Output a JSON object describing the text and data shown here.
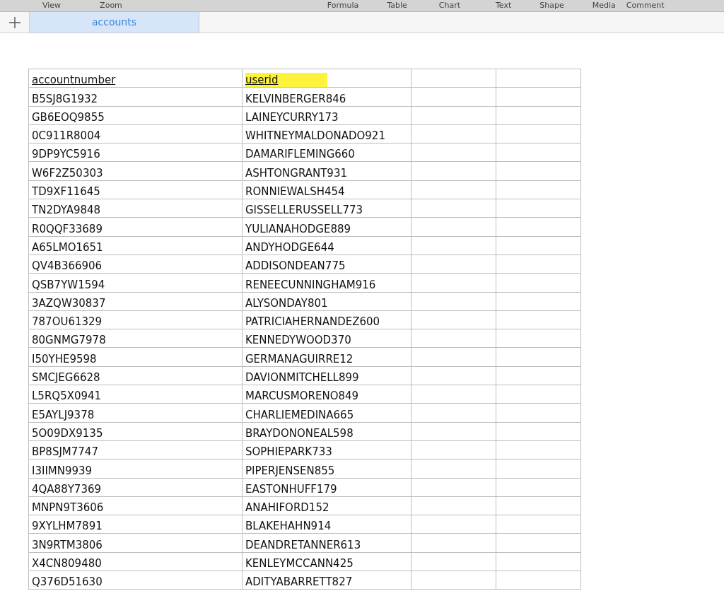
{
  "toolbar": {
    "items": [
      "View",
      "Zoom",
      "Formula",
      "Table",
      "Chart",
      "Text",
      "Shape",
      "Media",
      "Comment"
    ]
  },
  "sheet_tabs": [
    {
      "label": "accounts",
      "selected": true
    }
  ],
  "table": {
    "columns": [
      {
        "label": "accountnumber",
        "highlighted": false
      },
      {
        "label": "userid",
        "highlighted": true
      }
    ],
    "rows": [
      [
        "B5SJ8G1932",
        "KELVINBERGER846"
      ],
      [
        "GB6EOQ9855",
        "LAINEYCURRY173"
      ],
      [
        "0C911R8004",
        "WHITNEYMALDONADO921"
      ],
      [
        "9DP9YC5916",
        "DAMARIFLEMING660"
      ],
      [
        "W6F2Z50303",
        "ASHTONGRANT931"
      ],
      [
        "TD9XF11645",
        "RONNIEWALSH454"
      ],
      [
        "TN2DYA9848",
        "GISSELLERUSSELL773"
      ],
      [
        "R0QQF33689",
        "YULIANAHODGE889"
      ],
      [
        "A65LMO1651",
        "ANDYHODGE644"
      ],
      [
        "QV4B366906",
        "ADDISONDEAN775"
      ],
      [
        "QSB7YW1594",
        "RENEECUNNINGHAM916"
      ],
      [
        "3AZQW30837",
        "ALYSONDAY801"
      ],
      [
        "787OU61329",
        "PATRICIAHERNANDEZ600"
      ],
      [
        "80GNMG7978",
        "KENNEDYWOOD370"
      ],
      [
        "I50YHE9598",
        "GERMANAGUIRRE12"
      ],
      [
        "SMCJEG6628",
        "DAVIONMITCHELL899"
      ],
      [
        "L5RQ5X0941",
        "MARCUSMORENO849"
      ],
      [
        "E5AYLJ9378",
        "CHARLIEMEDINA665"
      ],
      [
        "5O09DX9135",
        "BRAYDONONEAL598"
      ],
      [
        "BP8SJM7747",
        "SOPHIEPARK733"
      ],
      [
        "I3IIMN9939",
        "PIPERJENSEN855"
      ],
      [
        "4QA88Y7369",
        "EASTONHUFF179"
      ],
      [
        "MNPN9T3606",
        "ANAHIFORD152"
      ],
      [
        "9XYLHM7891",
        "BLAKEHAHN914"
      ],
      [
        "3N9RTM3806",
        "DEANDRETANNER613"
      ],
      [
        "X4CN809480",
        "KENLEYMCCANN425"
      ],
      [
        "Q376D51630",
        "ADITYABARRETT827"
      ]
    ]
  }
}
